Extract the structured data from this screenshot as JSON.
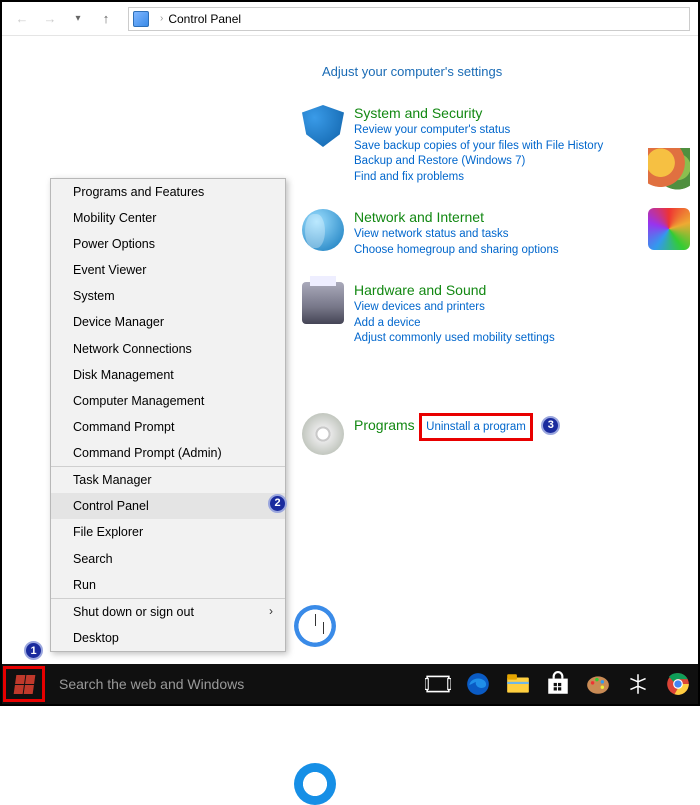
{
  "addressbar": {
    "location": "Control Panel"
  },
  "page": {
    "heading": "Adjust your computer's settings"
  },
  "categories": [
    {
      "title": "System and Security",
      "links": [
        "Review your computer's status",
        "Save backup copies of your files with File History",
        "Backup and Restore (Windows 7)",
        "Find and fix problems"
      ]
    },
    {
      "title": "Network and Internet",
      "links": [
        "View network status and tasks",
        "Choose homegroup and sharing options"
      ]
    },
    {
      "title": "Hardware and Sound",
      "links": [
        "View devices and printers",
        "Add a device",
        "Adjust commonly used mobility settings"
      ]
    },
    {
      "title": "Programs",
      "links": [
        "Uninstall a program"
      ]
    }
  ],
  "ctx_menu": {
    "g1": [
      "Programs and Features",
      "Mobility Center",
      "Power Options",
      "Event Viewer",
      "System",
      "Device Manager",
      "Network Connections",
      "Disk Management",
      "Computer Management",
      "Command Prompt",
      "Command Prompt (Admin)"
    ],
    "g2": [
      "Task Manager",
      "Control Panel",
      "File Explorer",
      "Search",
      "Run"
    ],
    "g3": [
      "Shut down or sign out",
      "Desktop"
    ],
    "highlighted": "Control Panel"
  },
  "taskbar": {
    "search_placeholder": "Search the web and Windows"
  },
  "annotations": {
    "n1": "1",
    "n2": "2",
    "n3": "3"
  }
}
